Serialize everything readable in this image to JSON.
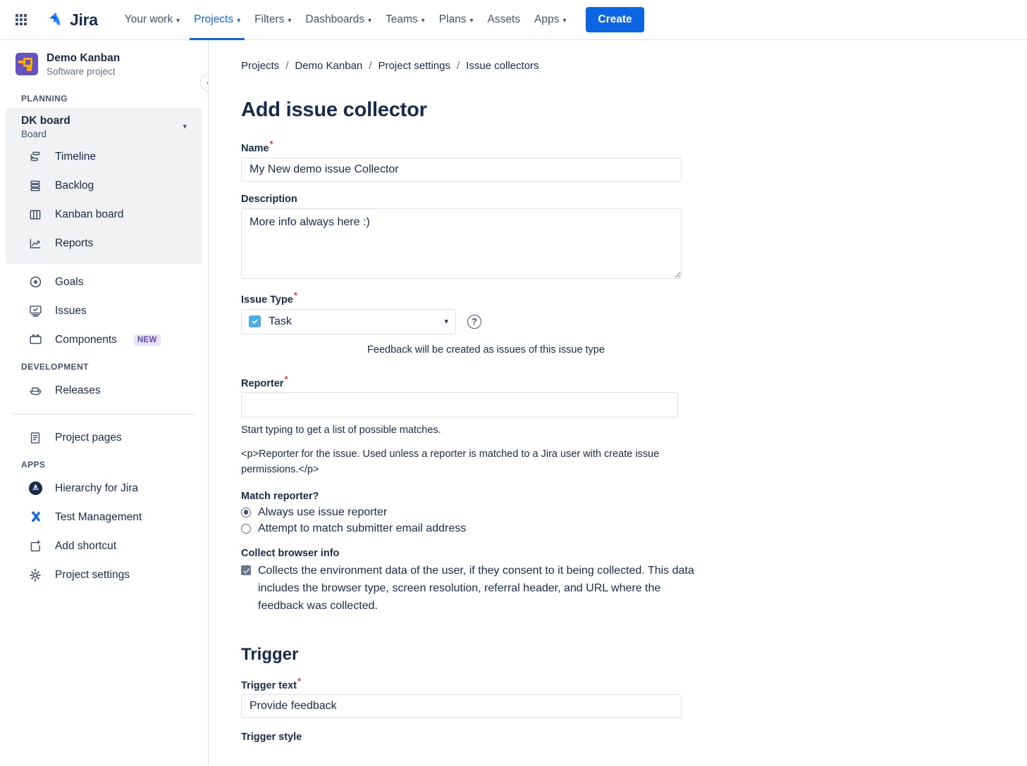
{
  "topnav": {
    "apps_switcher_name": "app-switcher",
    "brand": "Jira",
    "items": [
      {
        "label": "Your work",
        "has_chevron": true,
        "active": false
      },
      {
        "label": "Projects",
        "has_chevron": true,
        "active": true
      },
      {
        "label": "Filters",
        "has_chevron": true,
        "active": false
      },
      {
        "label": "Dashboards",
        "has_chevron": true,
        "active": false
      },
      {
        "label": "Teams",
        "has_chevron": true,
        "active": false
      },
      {
        "label": "Plans",
        "has_chevron": true,
        "active": false
      },
      {
        "label": "Assets",
        "has_chevron": false,
        "active": false
      },
      {
        "label": "Apps",
        "has_chevron": true,
        "active": false
      }
    ],
    "create_label": "Create",
    "create_color": "#0c66e4"
  },
  "sidebar": {
    "project_name": "Demo Kanban",
    "project_type": "Software project",
    "planning_label": "PLANNING",
    "board": {
      "name": "DK board",
      "subtitle": "Board"
    },
    "board_items": [
      {
        "label": "Timeline",
        "icon": "timeline-icon"
      },
      {
        "label": "Backlog",
        "icon": "backlog-icon"
      },
      {
        "label": "Kanban board",
        "icon": "board-icon"
      },
      {
        "label": "Reports",
        "icon": "reports-icon"
      }
    ],
    "planning_items": [
      {
        "label": "Goals",
        "icon": "goal-icon",
        "badge": ""
      },
      {
        "label": "Issues",
        "icon": "issues-icon",
        "badge": ""
      },
      {
        "label": "Components",
        "icon": "components-icon",
        "badge": "NEW"
      }
    ],
    "development_label": "DEVELOPMENT",
    "development_items": [
      {
        "label": "Releases",
        "icon": "releases-icon"
      }
    ],
    "pages_items": [
      {
        "label": "Project pages",
        "icon": "page-icon"
      }
    ],
    "apps_label": "APPS",
    "apps_items": [
      {
        "label": "Hierarchy for Jira",
        "icon": "hierarchy-app-icon"
      },
      {
        "label": "Test Management",
        "icon": "test-management-app-icon"
      },
      {
        "label": "Add shortcut",
        "icon": "add-shortcut-icon"
      },
      {
        "label": "Project settings",
        "icon": "gear-icon"
      }
    ],
    "badge_color": "#5e4db2",
    "badge_bg": "#e9e2fd"
  },
  "breadcrumb": [
    "Projects",
    "Demo Kanban",
    "Project settings",
    "Issue collectors"
  ],
  "page": {
    "title": "Add issue collector"
  },
  "form": {
    "name": {
      "label": "Name",
      "required": true,
      "value": "My New demo issue Collector"
    },
    "description": {
      "label": "Description",
      "required": false,
      "value": "More info always here :)"
    },
    "issue_type": {
      "label": "Issue Type",
      "required": true,
      "selected": "Task",
      "help_glyph": "?",
      "helper": "Feedback will be created as issues of this issue type"
    },
    "reporter": {
      "label": "Reporter",
      "required": true,
      "value": "",
      "placeholder": "",
      "helper1": "Start typing to get a list of possible matches.",
      "helper2": "<p>Reporter for the issue. Used unless a reporter is matched to a Jira user with create issue permissions.</p>"
    },
    "match_reporter": {
      "label": "Match reporter?",
      "options": [
        {
          "label": "Always use issue reporter",
          "selected": true
        },
        {
          "label": "Attempt to match submitter email address",
          "selected": false
        }
      ]
    },
    "collect_browser_info": {
      "label": "Collect browser info",
      "checked": true,
      "text": "Collects the environment data of the user, if they consent to it being collected. This data includes the browser type, screen resolution, referral header, and URL where the feedback was collected."
    }
  },
  "trigger": {
    "section_title": "Trigger",
    "trigger_text": {
      "label": "Trigger text",
      "required": true,
      "value": "Provide feedback"
    },
    "trigger_style": {
      "label": "Trigger style"
    }
  }
}
